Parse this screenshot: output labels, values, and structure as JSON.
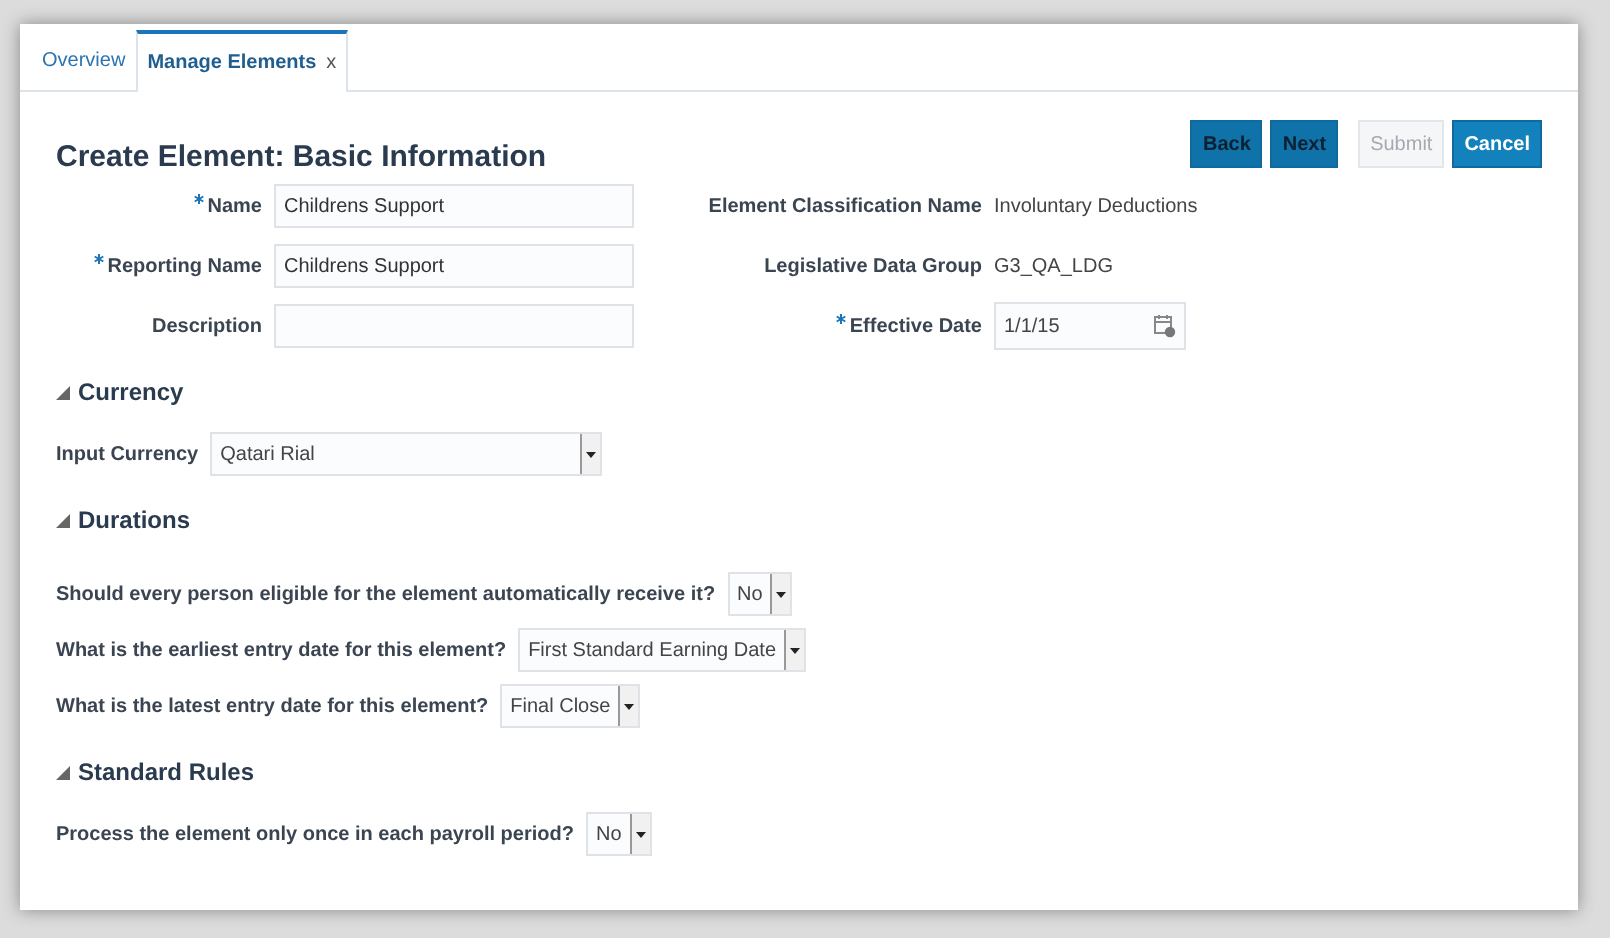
{
  "tabs": [
    {
      "label": "Overview",
      "selected": false,
      "closable": false
    },
    {
      "label": "Manage Elements",
      "selected": true,
      "closable": true
    }
  ],
  "close_glyph": "x",
  "page_title": "Create Element: Basic Information",
  "buttons": [
    {
      "label": "Back",
      "disabled": false,
      "kind": "nav"
    },
    {
      "label": "Next",
      "disabled": false,
      "kind": "nav"
    },
    {
      "label": "Submit",
      "disabled": true,
      "kind": "action"
    },
    {
      "label": "Cancel",
      "disabled": false,
      "kind": "action"
    }
  ],
  "basic_fields": [
    {
      "label": "Name",
      "required": true,
      "kind": "text",
      "value": "Childrens Support"
    },
    {
      "label": "Reporting Name",
      "required": true,
      "kind": "text",
      "value": "Childrens Support"
    },
    {
      "label": "Description",
      "required": false,
      "kind": "text"
    }
  ],
  "info_fields": [
    {
      "label": "Element Classification Name",
      "required": false,
      "kind": "readonly",
      "value": "Involuntary Deductions"
    },
    {
      "label": "Legislative Data Group",
      "required": false,
      "kind": "readonly",
      "value": "G3_QA_LDG"
    },
    {
      "label": "Effective Date",
      "required": true,
      "kind": "date",
      "value": "1/1/15"
    }
  ],
  "sections": [
    {
      "title": "Currency",
      "expanded": true,
      "fields": [
        {
          "label": "Input Currency",
          "value": "Qatari Rial",
          "wide": true
        }
      ]
    },
    {
      "title": "Durations",
      "expanded": true,
      "fields": [
        {
          "label": "Should every person eligible for the element automatically receive it?",
          "value": "No",
          "wide": false
        },
        {
          "label": "What is the earliest entry date for this element?",
          "value": "First Standard Earning Date",
          "wide": false
        },
        {
          "label": "What is the latest entry date for this element?",
          "value": "Final Close",
          "wide": false
        }
      ]
    },
    {
      "title": "Standard Rules",
      "expanded": true,
      "fields": [
        {
          "label": "Process the element only once in each payroll period?",
          "value": "No",
          "wide": false
        }
      ]
    }
  ]
}
